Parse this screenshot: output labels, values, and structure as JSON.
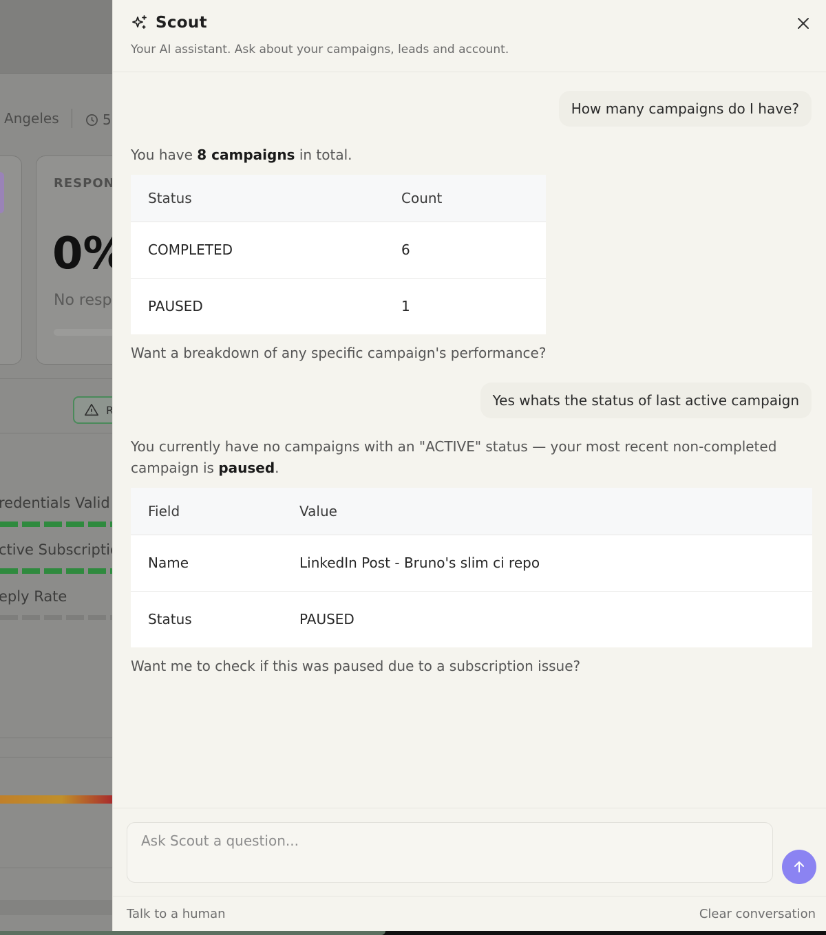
{
  "background": {
    "location": "Angeles",
    "clock_value": "5",
    "card_title": "RESPONS",
    "card_value": "0%",
    "card_sub": "No resp",
    "warn_text": "R",
    "checks": [
      "redentials Valid",
      "ctive Subscriptio",
      "eply Rate"
    ]
  },
  "scout": {
    "title": "Scout",
    "subtitle": "Your AI assistant. Ask about your campaigns, leads and account.",
    "icons": {
      "title": "sparkle-icon",
      "close": "close-icon",
      "send": "arrow-up-icon"
    }
  },
  "messages": {
    "user_1": "How many campaigns do I have?",
    "bot_1": {
      "prefix": "You have ",
      "bold": "8 campaigns",
      "suffix": " in total.",
      "table": {
        "headers": [
          "Status",
          "Count"
        ],
        "rows": [
          [
            "COMPLETED",
            "6"
          ],
          [
            "PAUSED",
            "1"
          ]
        ]
      },
      "followup": "Want a breakdown of any specific campaign's performance?"
    },
    "user_2": "Yes whats the status of last active campaign",
    "bot_2": {
      "prefix": "You currently have no campaigns with an \"ACTIVE\" status — your most recent non-completed campaign is ",
      "bold": "paused",
      "suffix": ".",
      "table": {
        "headers": [
          "Field",
          "Value"
        ],
        "rows": [
          [
            "Name",
            "LinkedIn Post - Bruno's slim ci repo"
          ],
          [
            "Status",
            "PAUSED"
          ]
        ]
      },
      "followup": "Want me to check if this was paused due to a subscription issue?"
    }
  },
  "composer": {
    "placeholder": "Ask Scout a question..."
  },
  "footer": {
    "left_link": "Talk to a human",
    "right_link": "Clear conversation"
  },
  "colors": {
    "accent": "#8b83f2",
    "panel_bg": "#f5f4ee",
    "success": "#2f8a3e"
  }
}
